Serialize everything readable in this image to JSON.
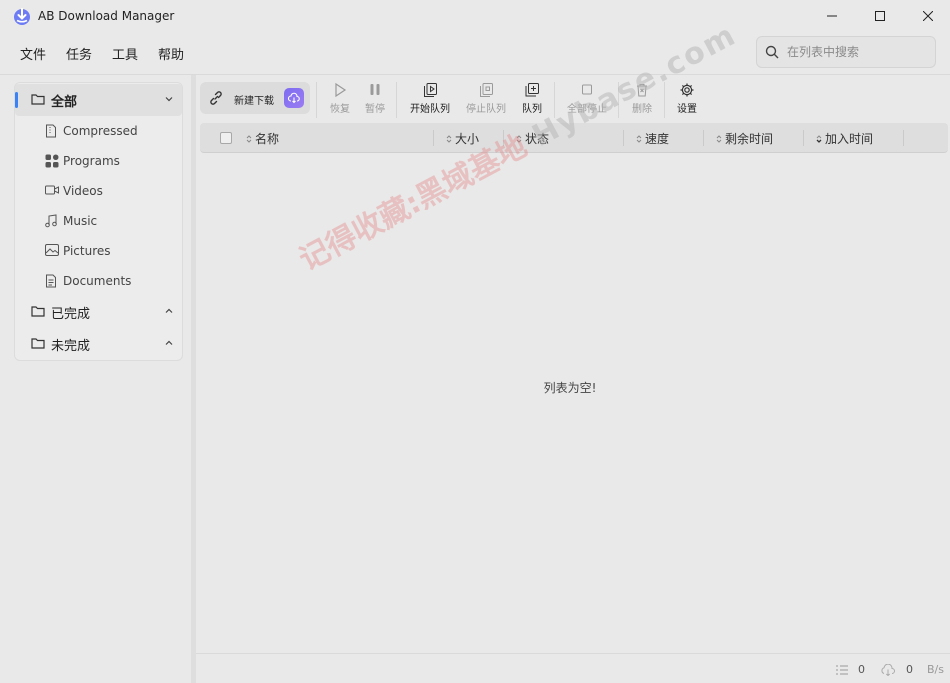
{
  "app": {
    "title": "AB Download Manager"
  },
  "menu": [
    "文件",
    "任务",
    "工具",
    "帮助"
  ],
  "search": {
    "placeholder": "在列表中搜索"
  },
  "sidebar": {
    "all": {
      "label": "全部"
    },
    "types": [
      {
        "label": "Compressed",
        "icon": "archive-icon"
      },
      {
        "label": "Programs",
        "icon": "apps-icon"
      },
      {
        "label": "Videos",
        "icon": "video-icon"
      },
      {
        "label": "Music",
        "icon": "music-icon"
      },
      {
        "label": "Pictures",
        "icon": "image-icon"
      },
      {
        "label": "Documents",
        "icon": "document-icon"
      }
    ],
    "finished": {
      "label": "已完成"
    },
    "unfinished": {
      "label": "未完成"
    }
  },
  "toolbar": {
    "new_download": "新建下载",
    "resume": "恢复",
    "pause": "暂停",
    "start_queue": "开始队列",
    "stop_queue": "停止队列",
    "queue": "队列",
    "stop_all": "全部停止",
    "delete": "删除",
    "settings": "设置"
  },
  "table": {
    "columns": [
      "名称",
      "大小",
      "状态",
      "速度",
      "剩余时间",
      "加入时间"
    ],
    "empty": "列表为空!"
  },
  "watermark": {
    "cn": "记得收藏:黑域基地",
    "en": "Hybase.com"
  },
  "status": {
    "count": "0",
    "speed_value": "0",
    "speed_unit": "B/s"
  },
  "colors": {
    "accent": "#3b82f6",
    "brand": "#7c6cf0"
  }
}
